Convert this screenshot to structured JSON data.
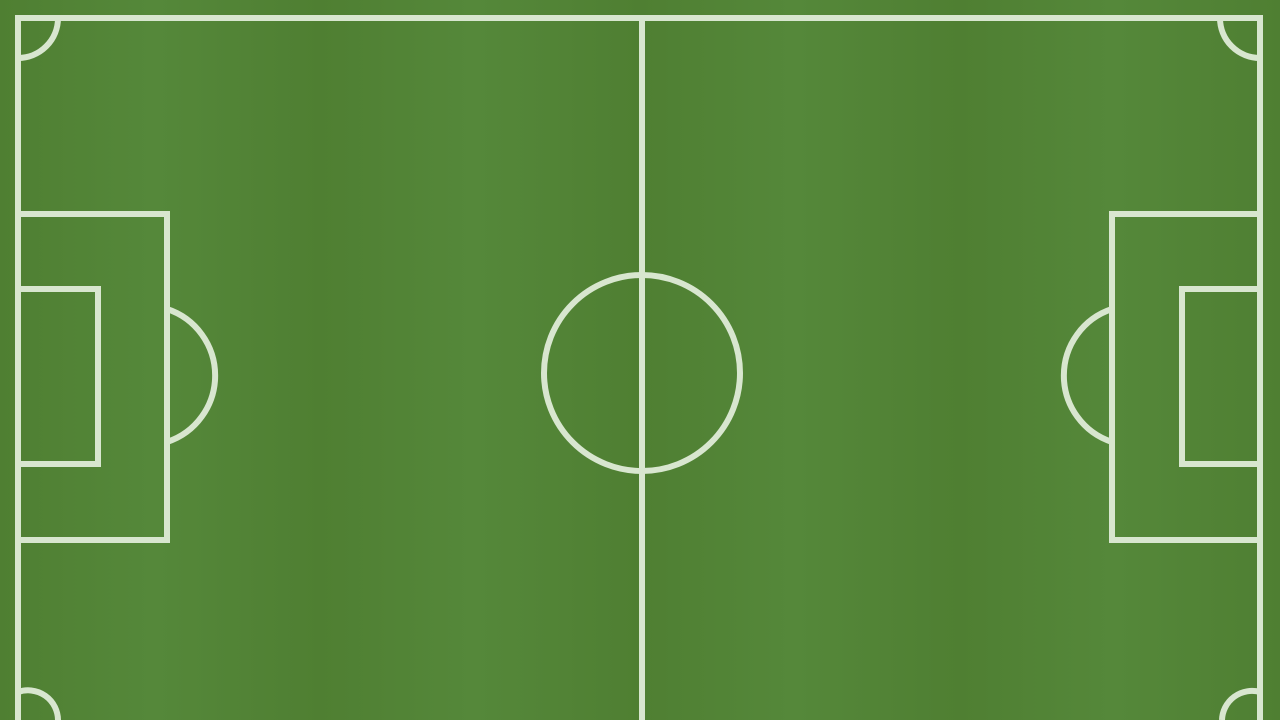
{
  "pitch": {
    "turf_color": "#4f7f32",
    "turf_stripe_color": "#55883a",
    "line_color": "#d8e6cf"
  }
}
